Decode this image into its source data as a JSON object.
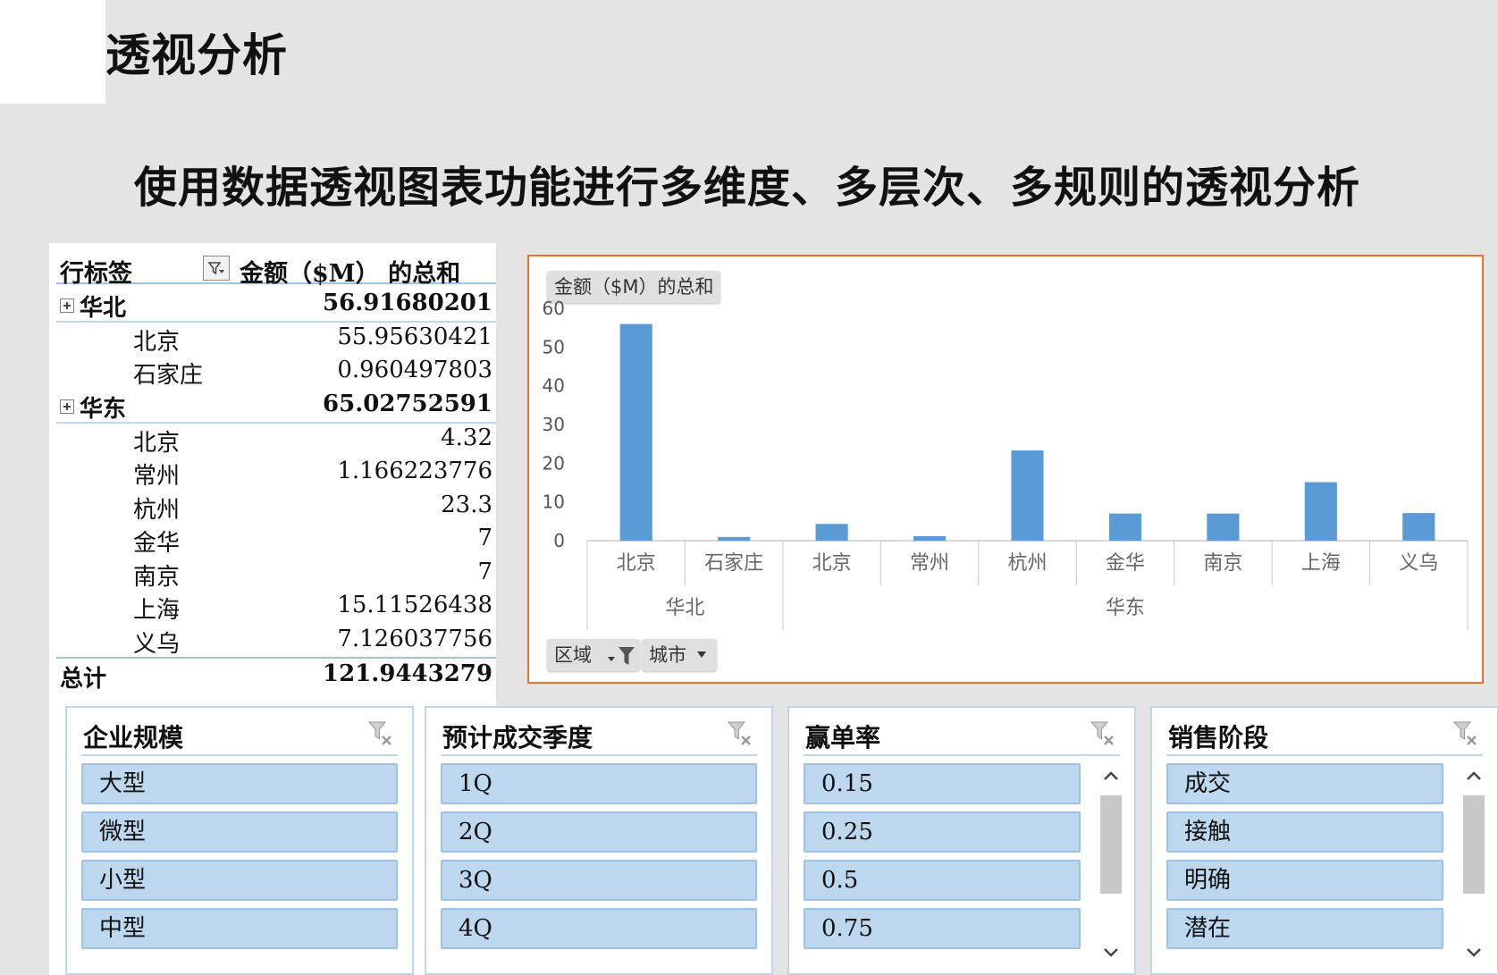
{
  "page": {
    "title": "透视分析",
    "subtitle": "使用数据透视图表功能进行多维度、多层次、多规则的透视分析"
  },
  "pivot": {
    "row_header": "行标签",
    "value_header": "金额（$M）  的总和",
    "groups": [
      {
        "name": "华北",
        "total": "56.91680201",
        "items": [
          {
            "name": "北京",
            "value": "55.95630421"
          },
          {
            "name": "石家庄",
            "value": "0.960497803"
          }
        ]
      },
      {
        "name": "华东",
        "total": "65.02752591",
        "items": [
          {
            "name": "北京",
            "value": "4.32"
          },
          {
            "name": "常州",
            "value": "1.166223776"
          },
          {
            "name": "杭州",
            "value": "23.3"
          },
          {
            "name": "金华",
            "value": "7"
          },
          {
            "name": "南京",
            "value": "7"
          },
          {
            "name": "上海",
            "value": "15.11526438"
          },
          {
            "name": "义乌",
            "value": "7.126037756"
          }
        ]
      }
    ],
    "grand_total_label": "总计",
    "grand_total": "121.9443279"
  },
  "chart_data": {
    "type": "bar",
    "series_tag": "金额（$M）的总和",
    "categories": [
      "北京",
      "石家庄",
      "北京",
      "常州",
      "杭州",
      "金华",
      "南京",
      "上海",
      "义乌"
    ],
    "groups": [
      {
        "name": "华北",
        "count": 2
      },
      {
        "name": "华东",
        "count": 7
      }
    ],
    "values": [
      55.95630421,
      0.960497803,
      4.32,
      1.166223776,
      23.3,
      7,
      7,
      15.11526438,
      7.126037756
    ],
    "ylim": [
      0,
      60
    ],
    "yticks": [
      0,
      10,
      20,
      30,
      40,
      50,
      60
    ],
    "bar_color": "#5b9bd5",
    "field_buttons": [
      "区域",
      "城市"
    ]
  },
  "slicers": [
    {
      "title": "企业规模",
      "items": [
        "大型",
        "微型",
        "小型",
        "中型"
      ],
      "scroll": false
    },
    {
      "title": "预计成交季度",
      "items": [
        "1Q",
        "2Q",
        "3Q",
        "4Q"
      ],
      "scroll": false
    },
    {
      "title": "赢单率",
      "items": [
        "0.15",
        "0.25",
        "0.5",
        "0.75"
      ],
      "scroll": true
    },
    {
      "title": "销售阶段",
      "items": [
        "成交",
        "接触",
        "明确",
        "潜在"
      ],
      "scroll": true
    }
  ],
  "colors": {
    "accent_border": "#e8732a",
    "slicer_fill": "#bdd7ee",
    "slicer_border": "#9dc3e6"
  }
}
